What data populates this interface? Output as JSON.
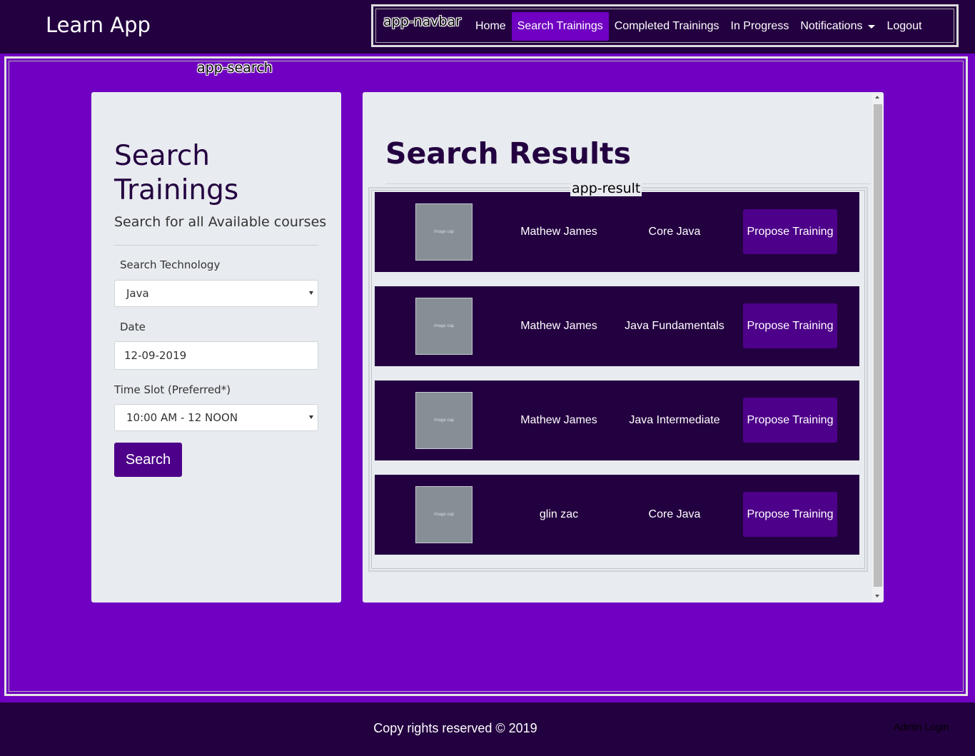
{
  "header": {
    "brand": "Learn App",
    "component_tag": "app-navbar",
    "nav": [
      {
        "label": "Home"
      },
      {
        "label": "Search Trainings"
      },
      {
        "label": "Completed Trainings"
      },
      {
        "label": "In Progress"
      },
      {
        "label": "Notifications"
      },
      {
        "label": "Logout"
      }
    ],
    "active_nav": "Search Trainings",
    "dropdown_icon": "chevron-down-icon"
  },
  "search": {
    "component_tag": "app-search",
    "title": "Search Trainings",
    "subtitle": "Search for all Available courses",
    "technology_label": "Search Technology",
    "technology_value": "Java",
    "date_label": "Date",
    "date_value": "12-09-2019",
    "timeslot_label": "Time Slot (Preferred*)",
    "timeslot_value": "10:00 AM - 12 NOON",
    "search_button": "Search"
  },
  "results": {
    "title": "Search Results",
    "component_tag": "app-result",
    "image_placeholder": "Image cap",
    "rows": [
      {
        "trainer": "Mathew James",
        "course": "Core Java",
        "action": "Propose Training"
      },
      {
        "trainer": "Mathew James",
        "course": "Java Fundamentals",
        "action": "Propose Training"
      },
      {
        "trainer": "Mathew James",
        "course": "Java Intermediate",
        "action": "Propose Training"
      },
      {
        "trainer": "glin zac",
        "course": "Core Java",
        "action": "Propose Training"
      }
    ]
  },
  "footer": {
    "copyright": "Copy rights reserved © 2019",
    "admin_login": "Admin Login"
  },
  "colors": {
    "header_bg": "#230040",
    "main_bg": "#7000c2",
    "card_bg": "#e8ebef",
    "button_bg": "#4d0089",
    "active_nav_bg": "#7000c2"
  }
}
